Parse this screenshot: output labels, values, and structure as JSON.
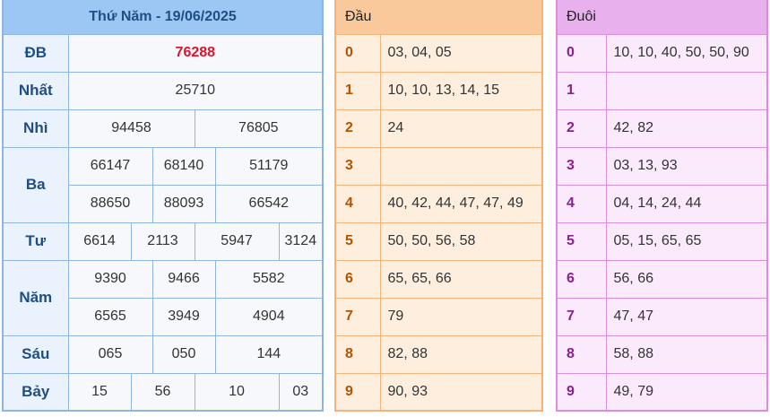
{
  "results": {
    "title": "Thứ Năm - 19/06/2025",
    "prizes": {
      "db": {
        "label": "ĐB",
        "values": [
          "76288"
        ]
      },
      "nhat": {
        "label": "Nhất",
        "values": [
          "25710"
        ]
      },
      "nhi": {
        "label": "Nhì",
        "values": [
          "94458",
          "76805"
        ]
      },
      "ba": {
        "label": "Ba",
        "values": [
          "66147",
          "68140",
          "51179",
          "88650",
          "88093",
          "66542"
        ]
      },
      "tu": {
        "label": "Tư",
        "values": [
          "6614",
          "2113",
          "5947",
          "3124"
        ]
      },
      "nam": {
        "label": "Năm",
        "values": [
          "9390",
          "9466",
          "5582",
          "6565",
          "3949",
          "4904"
        ]
      },
      "sau": {
        "label": "Sáu",
        "values": [
          "065",
          "050",
          "144"
        ]
      },
      "bay": {
        "label": "Bảy",
        "values": [
          "15",
          "56",
          "10",
          "03"
        ]
      }
    },
    "special_color": "#e0112b"
  },
  "dau": {
    "header": "Đầu",
    "rows": [
      {
        "digit": "0",
        "values": "03, 04, 05"
      },
      {
        "digit": "1",
        "values": "10, 10, 13, 14, 15"
      },
      {
        "digit": "2",
        "values": "24"
      },
      {
        "digit": "3",
        "values": ""
      },
      {
        "digit": "4",
        "values": "40, 42, 44, 47, 47, 49"
      },
      {
        "digit": "5",
        "values": "50, 50, 56, 58"
      },
      {
        "digit": "6",
        "values": "65, 65, 66"
      },
      {
        "digit": "7",
        "values": "79"
      },
      {
        "digit": "8",
        "values": "82, 88"
      },
      {
        "digit": "9",
        "values": "90, 93"
      }
    ]
  },
  "duoi": {
    "header": "Đuôi",
    "rows": [
      {
        "digit": "0",
        "values": "10, 10, 40, 50, 50, 90"
      },
      {
        "digit": "1",
        "values": ""
      },
      {
        "digit": "2",
        "values": "42, 82"
      },
      {
        "digit": "3",
        "values": "03, 13, 93"
      },
      {
        "digit": "4",
        "values": "04, 14, 24, 44"
      },
      {
        "digit": "5",
        "values": "05, 15, 65, 65"
      },
      {
        "digit": "6",
        "values": "56, 66"
      },
      {
        "digit": "7",
        "values": "47, 47"
      },
      {
        "digit": "8",
        "values": "58, 88"
      },
      {
        "digit": "9",
        "values": "49, 79"
      }
    ]
  }
}
